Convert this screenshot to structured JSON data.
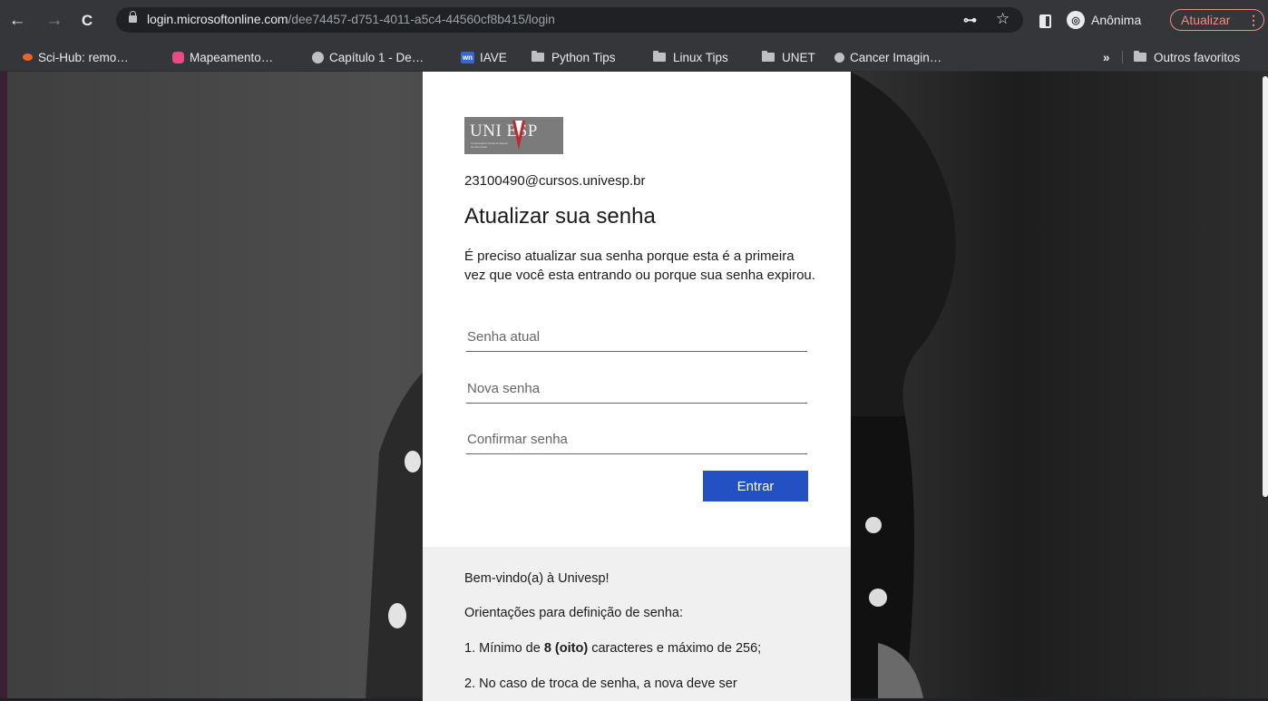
{
  "browser": {
    "url_host": "login.microsoftonline.com",
    "url_path": "/dee74457-d751-4011-a5c4-44560cf8b415/login",
    "profile_label": "Anônima",
    "update_label": "Atualizar",
    "menu_glyph": "⋮",
    "icons": {
      "back": "←",
      "forward": "→",
      "reload": "C",
      "key": "⊶",
      "star": "☆",
      "incognito": "◎"
    }
  },
  "bookmarks": {
    "items": [
      {
        "label": "Sci-Hub: remo…",
        "icon": "scihub-icon",
        "color": "#e8652d"
      },
      {
        "label": "Mapeamento…",
        "icon": "app-icon",
        "color": "#e84b86"
      },
      {
        "label": "Capítulo 1 - De…",
        "icon": "globe-icon",
        "color": "#bdc1c6"
      },
      {
        "label": "IAVE",
        "icon": "wn-icon",
        "color": "#3765d1",
        "icon_text": "wn"
      },
      {
        "label": "Python Tips",
        "icon": "folder-icon"
      },
      {
        "label": "Linux Tips",
        "icon": "folder-icon"
      },
      {
        "label": "UNET",
        "icon": "folder-icon"
      },
      {
        "label": "Cancer Imagin…",
        "icon": "cancer-icon",
        "color": "#bdc1c6"
      }
    ],
    "overflow": "»",
    "other": "Outros favoritos"
  },
  "login": {
    "logo_text": "UNI ESP",
    "logo_subtext": "Universidade Virtual do Estado de São Paulo",
    "account": "23100490@cursos.univesp.br",
    "title": "Atualizar sua senha",
    "description": "É preciso atualizar sua senha porque esta é a primeira vez que você esta entrando ou porque sua senha expirou.",
    "current_password_placeholder": "Senha atual",
    "new_password_placeholder": "Nova senha",
    "confirm_password_placeholder": "Confirmar senha",
    "submit_label": "Entrar"
  },
  "info": {
    "welcome": "Bem-vindo(a) à Univesp!",
    "guidelines_title": "Orientações para definição de senha:",
    "rule1_prefix": "1. Mínimo de ",
    "rule1_bold": "8 (oito)",
    "rule1_suffix": " caracteres e máximo de 256;",
    "rule2": "2. No caso de troca de senha, a nova deve ser"
  },
  "colors": {
    "chrome": "#35363a",
    "accent_button": "#2350c2",
    "update_button": "#f28b82",
    "logo_red": "#c1272d"
  }
}
